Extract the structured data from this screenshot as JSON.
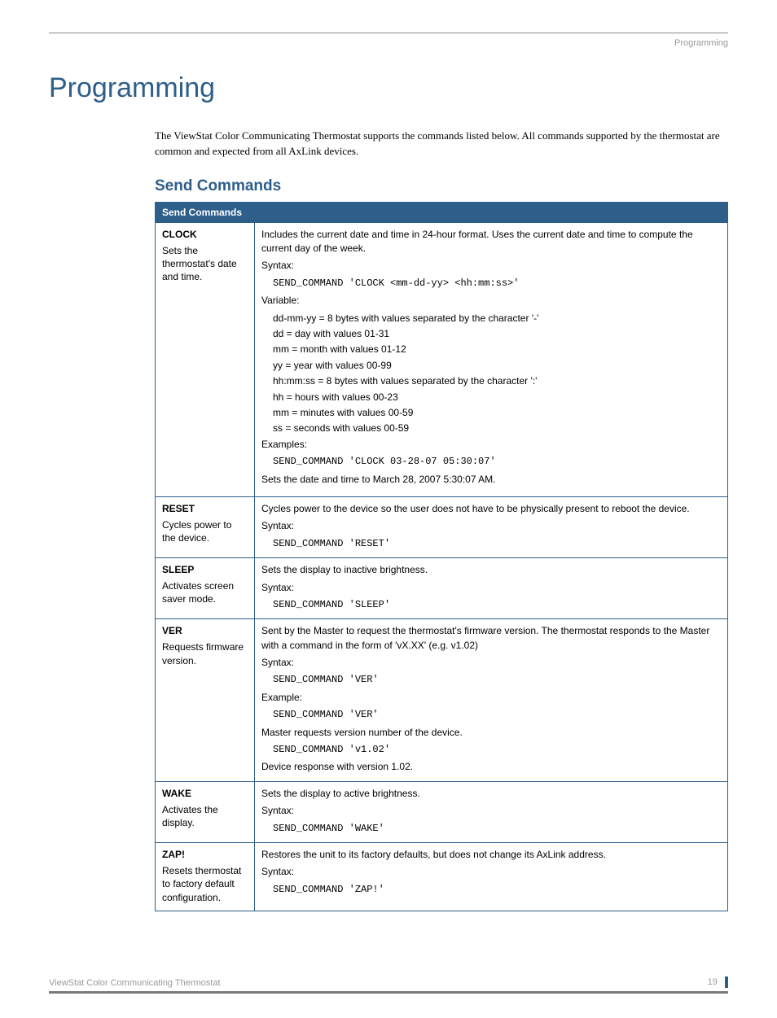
{
  "header": {
    "section": "Programming"
  },
  "title": "Programming",
  "intro": "The ViewStat Color Communicating Thermostat supports the commands listed below. All commands supported by the thermostat are common and expected from all AxLink devices.",
  "section_heading": "Send Commands",
  "table_title": "Send Commands",
  "rows": {
    "clock": {
      "name": "CLOCK",
      "desc": "Sets the thermostat's date and time.",
      "summary": "Includes the current date and time in 24-hour format. Uses the current date and time to compute the current day of the week.",
      "syntax_label": "Syntax:",
      "syntax_code": "SEND_COMMAND 'CLOCK <mm-dd-yy> <hh:mm:ss>'",
      "variable_label": "Variable:",
      "vars": [
        "dd-mm-yy = 8 bytes with values separated by the character '-'",
        "dd = day with values 01-31",
        "mm = month with values 01-12",
        "yy = year with values 00-99",
        "hh:mm:ss = 8 bytes with values separated by the character ':'",
        "hh = hours with values 00-23",
        "mm = minutes with values 00-59",
        "ss = seconds with values 00-59"
      ],
      "examples_label": "Examples:",
      "example_code": "SEND_COMMAND 'CLOCK 03-28-07 05:30:07'",
      "example_note": "Sets the date and time to March 28, 2007 5:30:07 AM."
    },
    "reset": {
      "name": "RESET",
      "desc": "Cycles power to the device.",
      "summary": "Cycles power to the device so the user does not have to be physically present to reboot the device.",
      "syntax_label": "Syntax:",
      "syntax_code": "SEND_COMMAND 'RESET'"
    },
    "sleep": {
      "name": "SLEEP",
      "desc": "Activates screen saver mode.",
      "summary": "Sets the display to inactive brightness.",
      "syntax_label": "Syntax:",
      "syntax_code": "SEND_COMMAND 'SLEEP'"
    },
    "ver": {
      "name": "VER",
      "desc": "Requests firmware version.",
      "summary": "Sent by the Master to request the thermostat's firmware version. The thermostat responds to the Master with a command in the form of 'vX.XX' (e.g. v1.02)",
      "syntax_label": "Syntax:",
      "syntax_code": "SEND_COMMAND 'VER'",
      "example_label": "Example:",
      "example_code1": "SEND_COMMAND 'VER'",
      "example_note1": "Master requests version number of the device.",
      "example_code2": "SEND_COMMAND 'v1.02'",
      "example_note2": "Device response with version 1.02."
    },
    "wake": {
      "name": "WAKE",
      "desc": "Activates the display.",
      "summary": "Sets the display to active brightness.",
      "syntax_label": "Syntax:",
      "syntax_code": "SEND_COMMAND 'WAKE'"
    },
    "zap": {
      "name": "ZAP!",
      "desc": "Resets thermostat to factory default configuration.",
      "summary": "Restores the unit to its factory defaults, but does not change its AxLink address.",
      "syntax_label": "Syntax:",
      "syntax_code": "SEND_COMMAND 'ZAP!'"
    }
  },
  "footer": {
    "left": "ViewStat Color Communicating Thermostat",
    "right": "19"
  }
}
